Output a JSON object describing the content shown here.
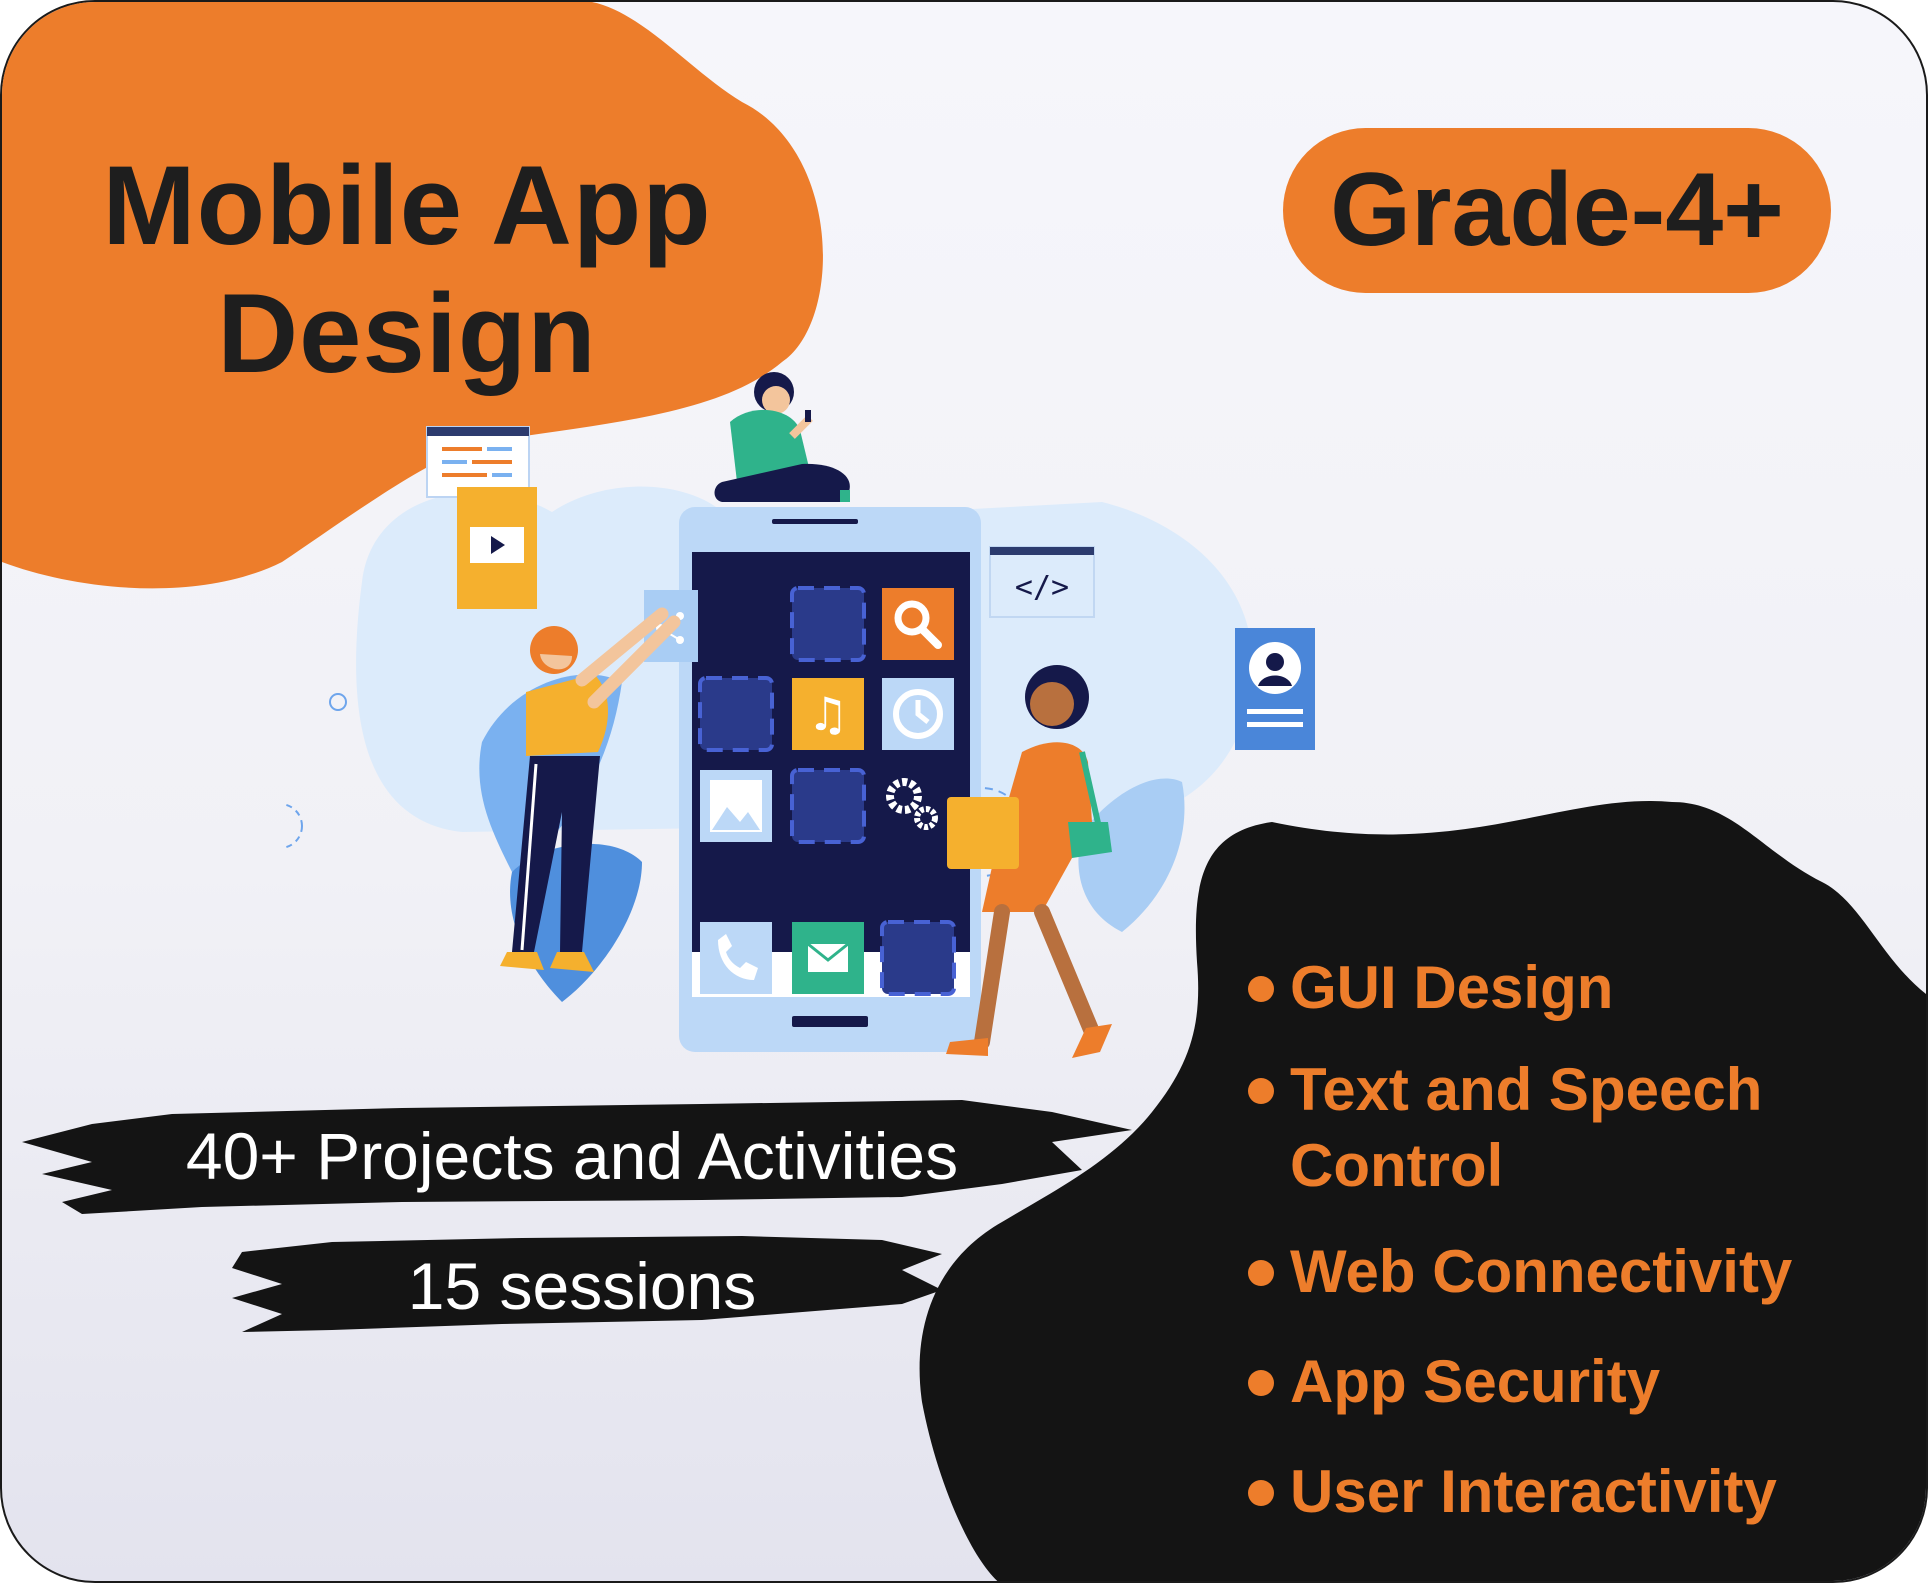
{
  "title": {
    "line1": "Mobile App",
    "line2": "Design"
  },
  "grade_badge": "Grade-4+",
  "stats": {
    "projects": "40+ Projects and Activities",
    "sessions": "15 sessions"
  },
  "features": [
    {
      "line1": "GUI Design",
      "line2": ""
    },
    {
      "line1": "Text and Speech",
      "line2": "Control"
    },
    {
      "line1": "Web Connectivity",
      "line2": ""
    },
    {
      "line1": "App Security",
      "line2": ""
    },
    {
      "line1": "User Interactivity",
      "line2": ""
    }
  ],
  "colors": {
    "accent_orange": "#ed7d2b",
    "dark": "#141414",
    "phone_screen": "#15194a",
    "light_blue": "#a9c8f5"
  },
  "icons": [
    "play-icon",
    "share-icon",
    "search-icon",
    "music-icon",
    "clock-icon",
    "image-icon",
    "gear-icon",
    "phone-call-icon",
    "mail-icon",
    "code-icon",
    "profile-card-icon"
  ]
}
